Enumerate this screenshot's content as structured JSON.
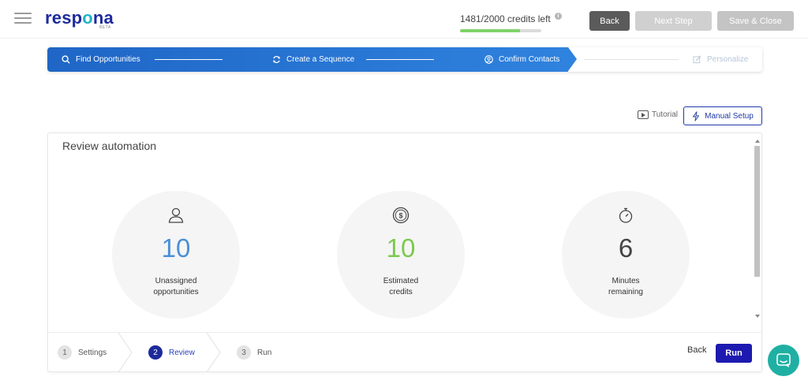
{
  "header": {
    "logo_text_a": "resp",
    "logo_text_o": "o",
    "logo_text_b": "na",
    "logo_badge": "BETA",
    "credits_text": "1481/2000 credits left",
    "credits_info": "i",
    "credits_progress": 0.74,
    "back_label": "Back",
    "next_label": "Next Step",
    "save_label": "Save & Close"
  },
  "stepper": {
    "steps": [
      {
        "label": "Find Opportunities",
        "icon": "search-icon"
      },
      {
        "label": "Create a Sequence",
        "icon": "refresh-icon"
      },
      {
        "label": "Confirm Contacts",
        "icon": "user-circle-icon"
      },
      {
        "label": "Personalize",
        "icon": "edit-icon"
      }
    ]
  },
  "toolbar": {
    "tutorial_label": "Tutorial",
    "manual_label": "Manual Setup"
  },
  "review": {
    "title": "Review automation",
    "stats": [
      {
        "value": "10",
        "label_line1": "Unassigned",
        "label_line2": "opportunities",
        "color": "#4a90d9",
        "icon": "user-icon"
      },
      {
        "value": "10",
        "label_line1": "Estimated",
        "label_line2": "credits",
        "color": "#7cc94f",
        "icon": "dollar-coin-icon"
      },
      {
        "value": "6",
        "label_line1": "Minutes",
        "label_line2": "remaining",
        "color": "#444444",
        "icon": "stopwatch-icon"
      }
    ]
  },
  "wizard": {
    "steps": [
      {
        "num": "1",
        "label": "Settings"
      },
      {
        "num": "2",
        "label": "Review"
      },
      {
        "num": "3",
        "label": "Run"
      }
    ],
    "back_label": "Back",
    "run_label": "Run"
  }
}
